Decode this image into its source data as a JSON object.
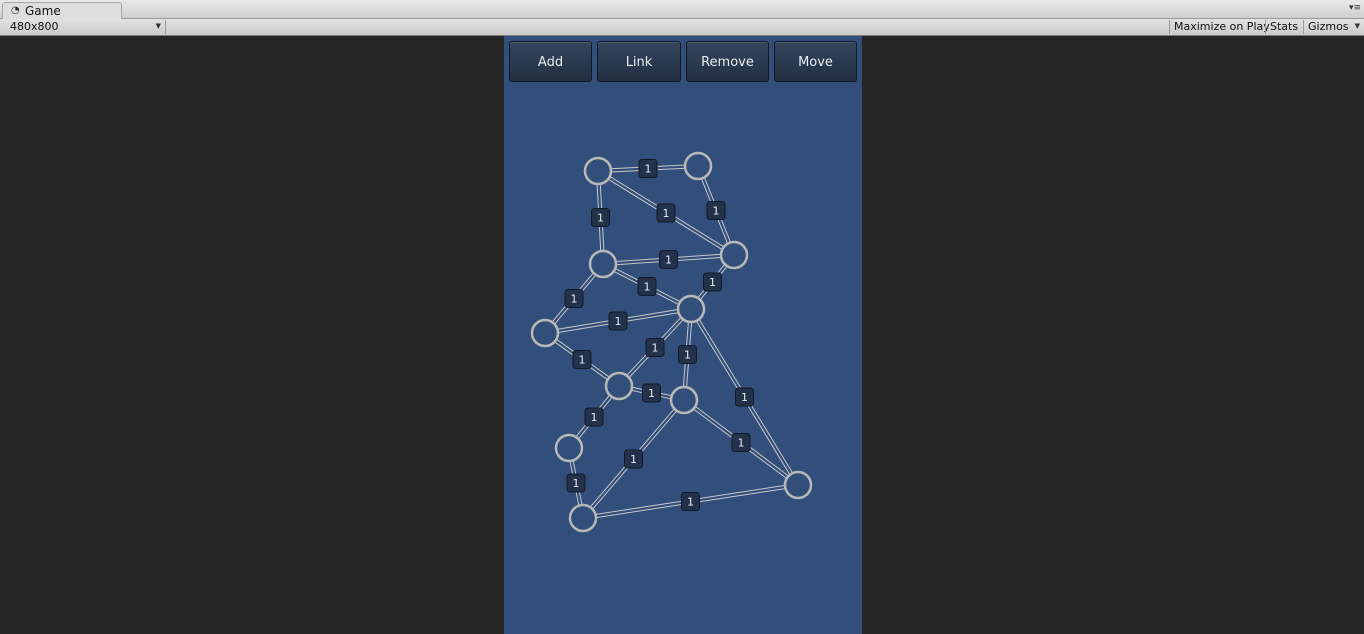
{
  "window": {
    "tab_title": "Game",
    "tab_icon": "unity-game-icon",
    "resolution": "480x800",
    "maximize_on_play": "Maximize on Play",
    "stats": "Stats",
    "gizmos": "Gizmos"
  },
  "game": {
    "buttons": [
      {
        "label": "Add"
      },
      {
        "label": "Link"
      },
      {
        "label": "Remove"
      },
      {
        "label": "Move"
      }
    ],
    "graph": {
      "nodes": [
        {
          "id": "n1"
        },
        {
          "id": "n2"
        },
        {
          "id": "n3"
        },
        {
          "id": "n4"
        },
        {
          "id": "n5"
        },
        {
          "id": "n6"
        },
        {
          "id": "n7"
        },
        {
          "id": "n8"
        },
        {
          "id": "n9"
        },
        {
          "id": "n10"
        },
        {
          "id": "n11"
        }
      ],
      "edges": [
        {
          "from": "n1",
          "to": "n2",
          "weight": "1"
        },
        {
          "from": "n1",
          "to": "n3",
          "weight": "1"
        },
        {
          "from": "n1",
          "to": "n4",
          "weight": "1"
        },
        {
          "from": "n2",
          "to": "n4",
          "weight": "1"
        },
        {
          "from": "n3",
          "to": "n4",
          "weight": "1"
        },
        {
          "from": "n3",
          "to": "n6",
          "weight": "1"
        },
        {
          "from": "n3",
          "to": "n5",
          "weight": "1"
        },
        {
          "from": "n4",
          "to": "n6",
          "weight": "1"
        },
        {
          "from": "n5",
          "to": "n6",
          "weight": "1"
        },
        {
          "from": "n5",
          "to": "n7",
          "weight": "1"
        },
        {
          "from": "n6",
          "to": "n7",
          "weight": "1"
        },
        {
          "from": "n6",
          "to": "n8",
          "weight": "1"
        },
        {
          "from": "n6",
          "to": "n11",
          "weight": "1"
        },
        {
          "from": "n7",
          "to": "n8",
          "weight": "1"
        },
        {
          "from": "n7",
          "to": "n9",
          "weight": "1"
        },
        {
          "from": "n8",
          "to": "n10",
          "weight": "1"
        },
        {
          "from": "n8",
          "to": "n11",
          "weight": "1"
        },
        {
          "from": "n9",
          "to": "n10",
          "weight": "1"
        },
        {
          "from": "n10",
          "to": "n11",
          "weight": "1"
        }
      ]
    }
  },
  "colors": {
    "game_background": "#314f7a",
    "node_stroke": "#b8b8b8",
    "edge_stroke": "#c8c8c8",
    "weight_badge": "#23324a"
  }
}
